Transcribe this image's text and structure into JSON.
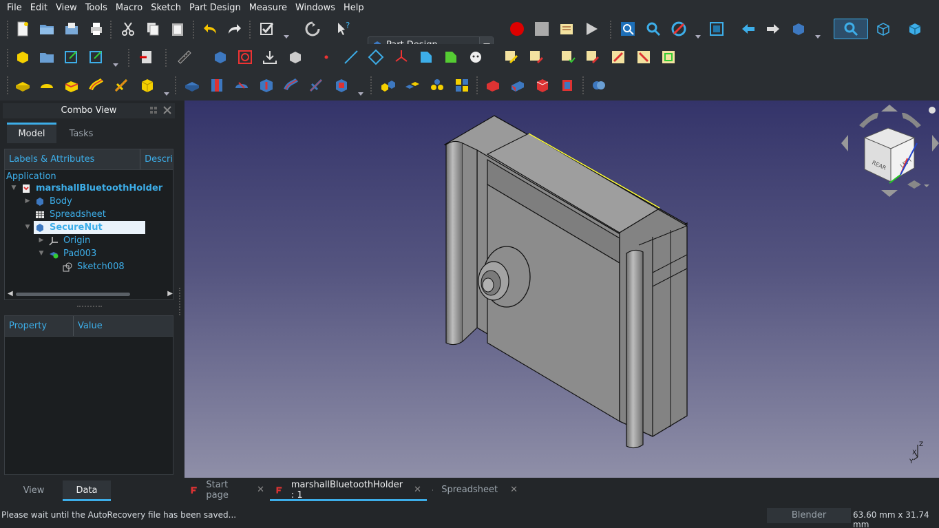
{
  "menubar": {
    "items": [
      {
        "label": "File"
      },
      {
        "label": "Edit"
      },
      {
        "label": "View"
      },
      {
        "label": "Tools"
      },
      {
        "label": "Macro"
      },
      {
        "label": "Sketch"
      },
      {
        "label": "Part Design"
      },
      {
        "label": "Measure"
      },
      {
        "label": "Windows"
      },
      {
        "label": "Help"
      }
    ]
  },
  "toolbar": {
    "workbench": "Part Design"
  },
  "combo_view": {
    "title": "Combo View",
    "tabs": {
      "model": "Model",
      "tasks": "Tasks"
    },
    "tree_header": {
      "labels": "Labels & Attributes",
      "description": "Descri"
    },
    "tree": {
      "application": "Application",
      "document": "marshallBluetoothHolder",
      "body": "Body",
      "spreadsheet": "Spreadsheet",
      "securenut": "SecureNut",
      "origin": "Origin",
      "pad": "Pad003",
      "sketch": "Sketch008"
    },
    "property_header": {
      "property": "Property",
      "value": "Value"
    },
    "bottom_tabs": {
      "view": "View",
      "data": "Data"
    }
  },
  "doc_tabs": {
    "start": "Start page",
    "doc": "marshallBluetoothHolder : 1",
    "spreadsheet": "Spreadsheet"
  },
  "navcube": {
    "top": "",
    "rear": "REAR",
    "left": "LEFT"
  },
  "axis": {
    "z": "Z",
    "x": "X",
    "y": "Y"
  },
  "status": {
    "message": "Please wait until the AutoRecovery file has been saved...",
    "nav_style": "Blender",
    "dimensions": "63.60 mm x 31.74 mm"
  }
}
